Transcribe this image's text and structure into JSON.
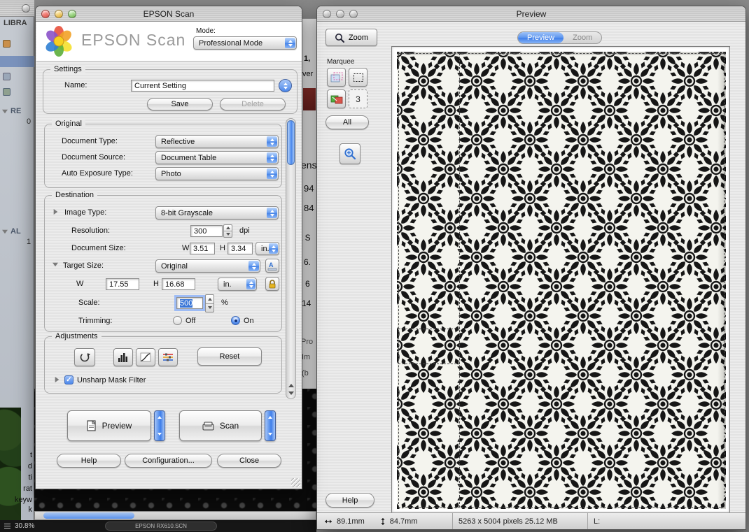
{
  "desktop": {
    "sidebar": {
      "library": "LIBRA",
      "recent_label": "RE",
      "recent_badge": "0",
      "albums_label": "AL",
      "albums_badge": "1",
      "info_labels": [
        "t",
        "d",
        "ti",
        "rat",
        "keyw",
        "k"
      ]
    },
    "bottom_bar": {
      "zoom_pct": "30.8%",
      "file_pill": "EPSON RX610.SCN"
    },
    "fragments": [
      "1,",
      "ver",
      "ens",
      "94",
      "84",
      "t S",
      "6.",
      "6",
      "14",
      "Pro",
      "Im",
      "(b"
    ]
  },
  "scan": {
    "window_title": "EPSON Scan",
    "brand": "EPSON Scan",
    "mode_label": "Mode:",
    "mode_value": "Professional Mode",
    "settings": {
      "legend": "Settings",
      "name_label": "Name:",
      "name_value": "Current Setting",
      "save_label": "Save",
      "delete_label": "Delete"
    },
    "original": {
      "legend": "Original",
      "document_type_label": "Document Type:",
      "document_type_value": "Reflective",
      "document_source_label": "Document Source:",
      "document_source_value": "Document Table",
      "auto_exposure_label": "Auto Exposure Type:",
      "auto_exposure_value": "Photo"
    },
    "destination": {
      "legend": "Destination",
      "image_type_label": "Image Type:",
      "image_type_value": "8-bit Grayscale",
      "resolution_label": "Resolution:",
      "resolution_value": "300",
      "resolution_unit": "dpi",
      "document_size_label": "Document Size:",
      "w_label": "W",
      "h_label": "H",
      "doc_w": "3.51",
      "doc_h": "3.34",
      "unit_value": "in.",
      "target_size_label": "Target Size:",
      "target_size_value": "Original",
      "target_w": "17.55",
      "target_h": "16.68",
      "target_unit": "in.",
      "scale_label": "Scale:",
      "scale_value": "500",
      "scale_unit": "%",
      "trimming_label": "Trimming:",
      "off_label": "Off",
      "on_label": "On"
    },
    "adjustments": {
      "legend": "Adjustments",
      "reset_label": "Reset",
      "unsharp_label": "Unsharp Mask Filter"
    },
    "actions": {
      "preview_label": "Preview",
      "scan_label": "Scan",
      "help_label": "Help",
      "configuration_label": "Configuration...",
      "close_label": "Close"
    }
  },
  "preview": {
    "window_title": "Preview",
    "zoom_button_label": "Zoom",
    "tab_preview": "Preview",
    "tab_zoom": "Zoom",
    "marquee_label": "Marquee",
    "marquee_count": "3",
    "all_label": "All",
    "help_label": "Help",
    "status": {
      "width_value": "89.1mm",
      "height_value": "84.7mm",
      "size_value": "5263 x 5004 pixels 25.12 MB",
      "l_label": "L:"
    }
  }
}
